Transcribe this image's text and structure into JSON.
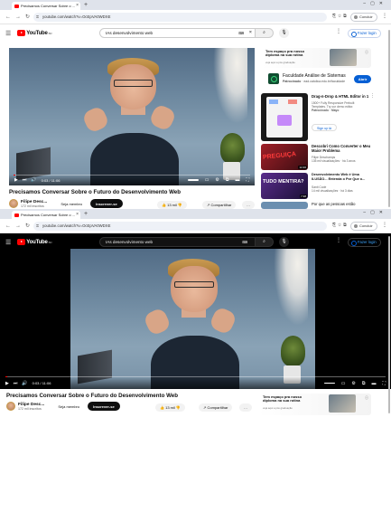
{
  "browser": {
    "tab_title": "Precisamos Conversar Sobre o ...",
    "url": "youtube.com/watch?v=OcEpVA0WDXE",
    "profile_label": "Concluir"
  },
  "youtube": {
    "logo_text": "YouTube",
    "logo_country": "BR",
    "search_value": "IAs desenvolvimento web",
    "signin_label": "Fazer login"
  },
  "video": {
    "title": "Precisamos Conversar Sobre o Futuro do Desenvolvimento Web",
    "time": "0:03 / 11:06",
    "progress": 0.005,
    "channel_name": "Filipe Desc...",
    "channel_subs": "172 mil inscritos",
    "join_label": "Seja membro",
    "subscribe_label": "Inscrever-se",
    "likes": "13 mil",
    "share_label": "Compartilhar"
  },
  "ad": {
    "banner_head_1": "Tem espaço pra nosso",
    "banner_head_2": "diploma na sua rotina",
    "banner_sub": "veja aqui a pós graduação",
    "title": "Faculdade Análise de Sistemas",
    "badge": "Patrocinado",
    "domain": "ead.catolica.edu.br/faculdade",
    "cta": "Abrir"
  },
  "suggestions": [
    {
      "title": "Drag-n-Drop & HTML Editor in 1",
      "meta1": "1500+ Fully Responsive Prebuilt",
      "meta2": "Templates. Try our demo editor.",
      "meta3": "Patrocinado · Mayo",
      "cta": "Sign up"
    },
    {
      "title": "Descobri Como Converter o Meu Maior Problema",
      "channel": "Filipe Deschamps",
      "stats": "135 mil visualizações · há 3 anos",
      "duration": "12:46",
      "thumb_text": "PREGUIÇA"
    },
    {
      "title": "Desenvolvimento Web é Uma ILUSÃO... Entenda o Por Que o...",
      "channel": "Santi Code",
      "stats": "14 mil visualizações · há 3 dias",
      "duration": "7:38",
      "thumb_text": "TUDO MENTIRA?"
    },
    {
      "title": "Por que as pessoas estão"
    }
  ],
  "colors": {
    "accent_red": "#ff0000",
    "link_blue": "#065fd4"
  }
}
